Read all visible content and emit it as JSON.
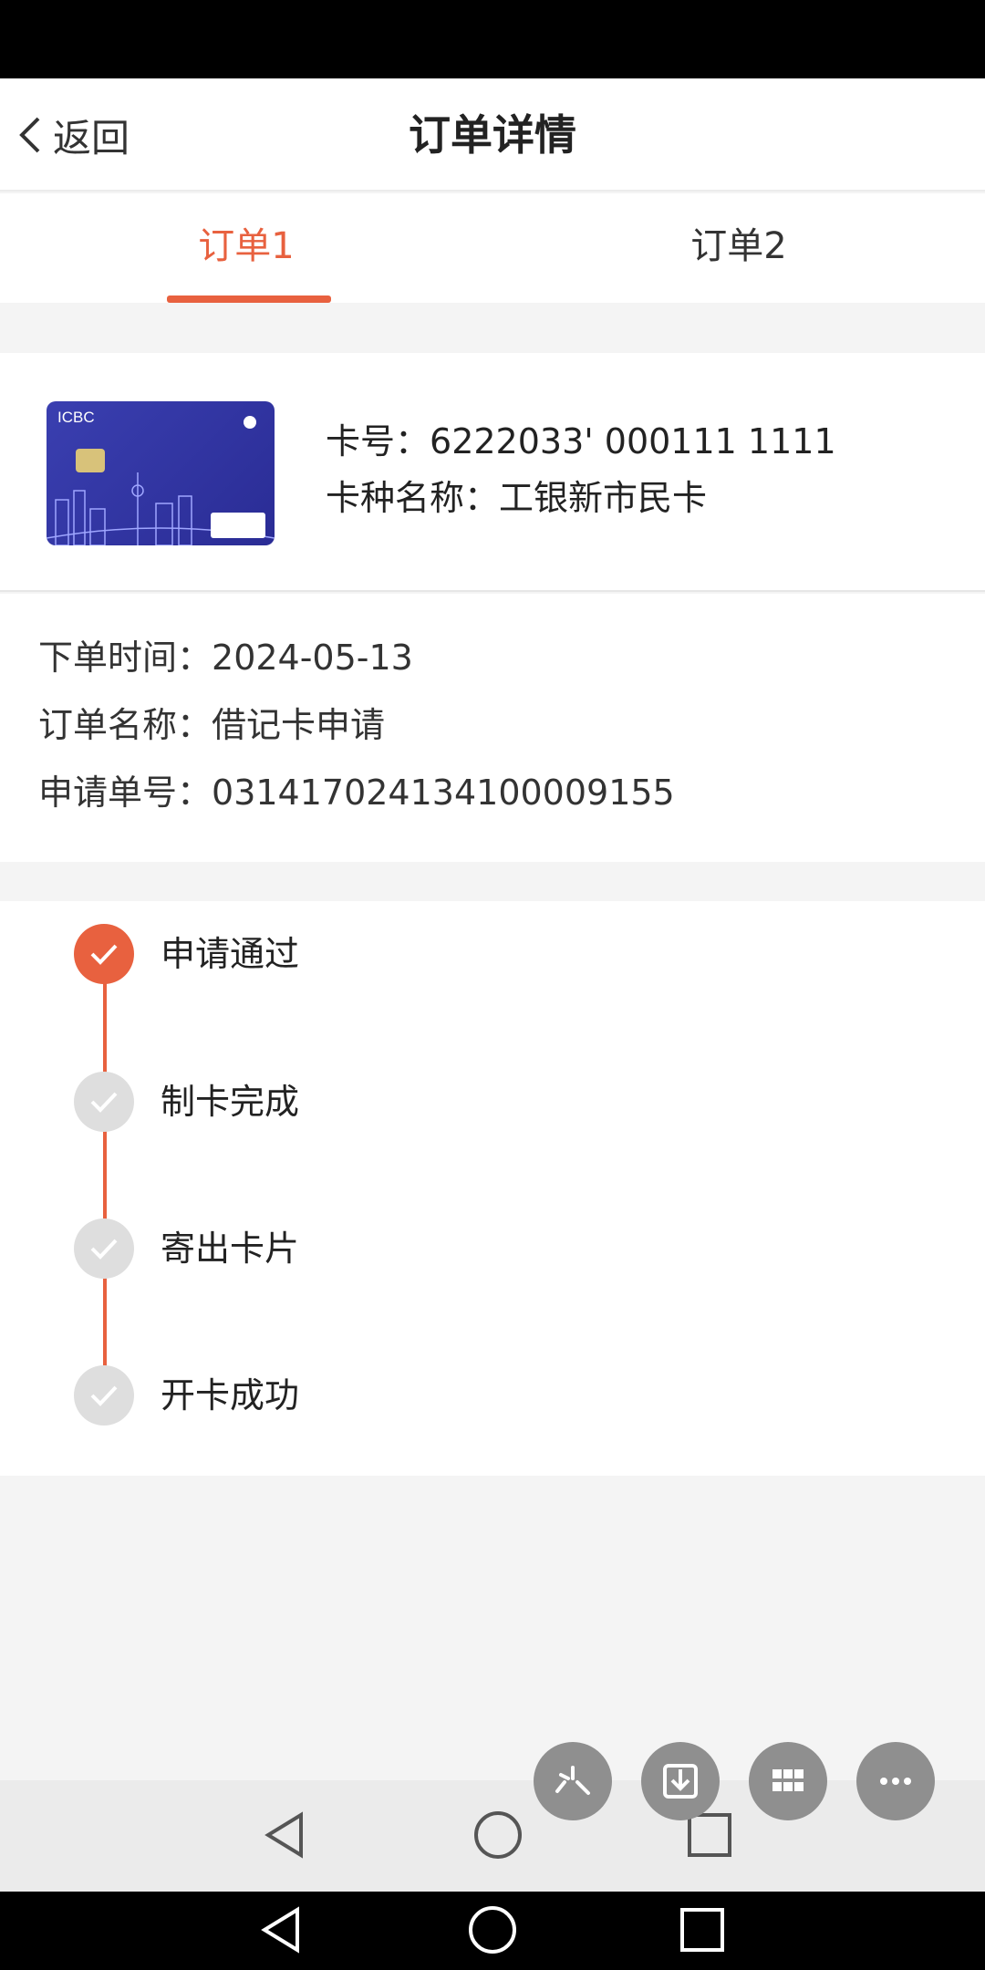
{
  "header": {
    "back_label": "返回",
    "title": "订单详情"
  },
  "tabs": [
    {
      "label": "订单1",
      "active": true
    },
    {
      "label": "订单2",
      "active": false
    }
  ],
  "card": {
    "brand_text": "ICBC",
    "number_label": "卡号：",
    "number_value": "6222033' 000111  1111",
    "type_label": "卡种名称：",
    "type_value": "工银新市民卡"
  },
  "details": {
    "order_time_label": "下单时间：",
    "order_time_value": "2024-05-13",
    "order_name_label": "订单名称：",
    "order_name_value": "借记卡申请",
    "application_no_label": "申请单号：",
    "application_no_value": "031417024134100009155"
  },
  "steps": [
    {
      "label": "申请通过",
      "status": "done"
    },
    {
      "label": "制卡完成",
      "status": "pending"
    },
    {
      "label": "寄出卡片",
      "status": "pending"
    },
    {
      "label": "开卡成功",
      "status": "pending"
    }
  ],
  "colors": {
    "accent": "#e8613f",
    "pending": "#dedede",
    "fab": "#8f8f8f"
  },
  "fabs": [
    {
      "icon": "sparkle-icon"
    },
    {
      "icon": "download-icon"
    },
    {
      "icon": "grid-icon"
    },
    {
      "icon": "more-icon"
    }
  ],
  "nav": {
    "icons": [
      "back-triangle-icon",
      "home-circle-icon",
      "recents-square-icon"
    ]
  }
}
